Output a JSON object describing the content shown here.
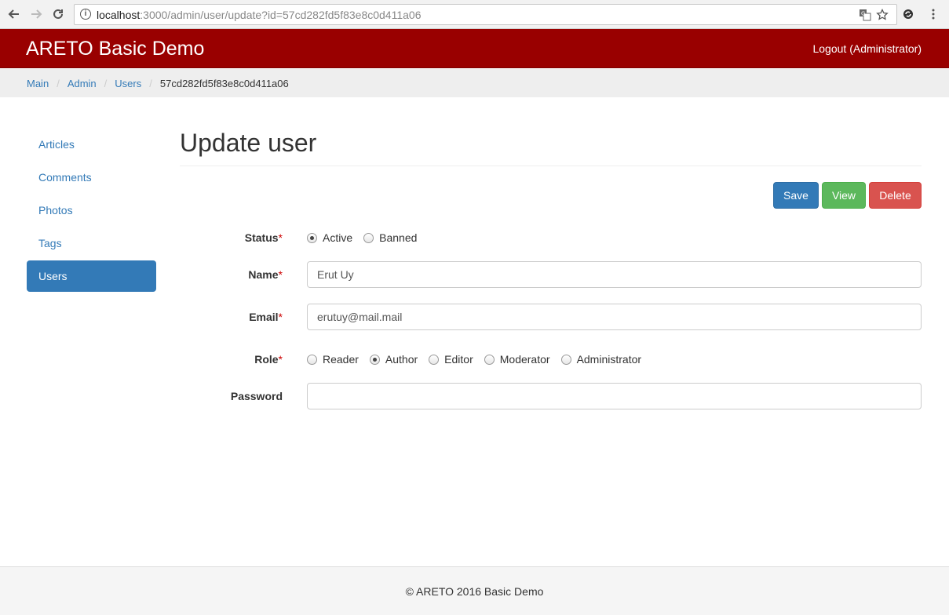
{
  "browser": {
    "url_host": "localhost",
    "url_rest": ":3000/admin/user/update?id=57cd282fd5f83e8c0d411a06"
  },
  "navbar": {
    "brand": "ARETO Basic Demo",
    "logout": "Logout (Administrator)",
    "color": "#990000"
  },
  "breadcrumb": {
    "items": [
      "Main",
      "Admin",
      "Users"
    ],
    "active": "57cd282fd5f83e8c0d411a06"
  },
  "sidebar": {
    "items": [
      "Articles",
      "Comments",
      "Photos",
      "Tags",
      "Users"
    ],
    "active": "Users"
  },
  "main": {
    "title": "Update user",
    "buttons": {
      "save": "Save",
      "view": "View",
      "delete": "Delete"
    },
    "form": {
      "status": {
        "label": "Status",
        "options": [
          "Active",
          "Banned"
        ],
        "selected": "Active"
      },
      "name": {
        "label": "Name",
        "value": "Erut Uy"
      },
      "email": {
        "label": "Email",
        "value": "erutuy@mail.mail"
      },
      "role": {
        "label": "Role",
        "options": [
          "Reader",
          "Author",
          "Editor",
          "Moderator",
          "Administrator"
        ],
        "selected": "Author"
      },
      "password": {
        "label": "Password",
        "value": ""
      },
      "required_mark": "*"
    }
  },
  "footer": {
    "text": "© ARETO 2016 Basic Demo"
  }
}
